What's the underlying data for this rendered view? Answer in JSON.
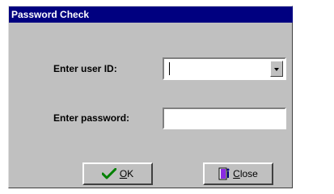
{
  "window": {
    "title": "Password Check"
  },
  "form": {
    "user_id_label": "Enter user ID:",
    "user_id_value": "",
    "password_label": "Enter password:",
    "password_value": ""
  },
  "buttons": {
    "ok_label": "OK",
    "close_label": "Close"
  },
  "icons": {
    "ok": "checkmark-icon",
    "close": "door-exit-icon",
    "dropdown": "chevron-down-icon"
  },
  "colors": {
    "titlebar": "#000080",
    "dialog_bg": "#c0c0c0",
    "checkmark": "#008000"
  }
}
